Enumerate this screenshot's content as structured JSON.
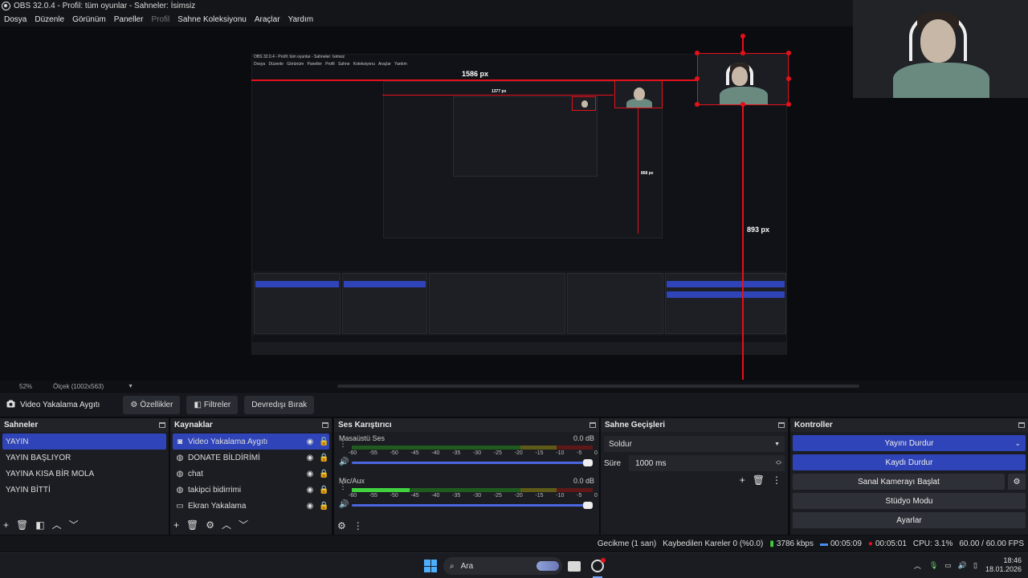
{
  "window": {
    "title": "OBS 32.0.4 - Profil: tüm oyunlar - Sahneler: İsimsiz"
  },
  "menu": [
    {
      "label": "Dosya",
      "enabled": true
    },
    {
      "label": "Düzenle",
      "enabled": true
    },
    {
      "label": "Görünüm",
      "enabled": true
    },
    {
      "label": "Paneller",
      "enabled": true
    },
    {
      "label": "Profil",
      "enabled": false
    },
    {
      "label": "Sahne Koleksiyonu",
      "enabled": true
    },
    {
      "label": "Araçlar",
      "enabled": true
    },
    {
      "label": "Yardım",
      "enabled": true
    }
  ],
  "preview": {
    "width_label": "1586 px",
    "height_label": "893 px",
    "nested_width_label": "1377 px",
    "nested_height_label": "868 px",
    "nested_title": "OBS 32.0.4 - Profil: tüm oyunlar - Sahneler: İsimsiz",
    "nested_menu": "Dosya Düzenle Görünüm Paneller Profil Sahne Koleksiyonu Araçlar Yardım"
  },
  "zoom": {
    "percent": "52%",
    "scale_label": "Ölçek (1002x563)"
  },
  "source_toolbar": {
    "selected_source": "Video Yakalama Aygıtı",
    "properties": "Özellikler",
    "filters": "Filtreler",
    "deactivate": "Devredışı Bırak"
  },
  "scenes": {
    "title": "Sahneler",
    "items": [
      "YAYIN",
      "YAYIN BAŞLIYOR",
      "YAYINA KISA BİR MOLA",
      "YAYIN BİTTİ"
    ],
    "selected_index": 0
  },
  "sources": {
    "title": "Kaynaklar",
    "items": [
      {
        "label": "Video Yakalama Aygıtı",
        "icon": "camera-icon",
        "selected": true
      },
      {
        "label": "DONATE BİLDİRİMİ",
        "icon": "globe-icon",
        "selected": false
      },
      {
        "label": "chat",
        "icon": "globe-icon",
        "selected": false
      },
      {
        "label": "takipci bidirrimi",
        "icon": "globe-icon",
        "selected": false
      },
      {
        "label": "Ekran Yakalama",
        "icon": "monitor-icon",
        "selected": false
      }
    ]
  },
  "mixer": {
    "title": "Ses Karıştırıcı",
    "channels": [
      {
        "name": "Masaüstü Ses",
        "db": "0.0 dB",
        "level": 0.0
      },
      {
        "name": "Mic/Aux",
        "db": "0.0 dB",
        "level": 0.24
      }
    ],
    "ticks": [
      "-60",
      "-55",
      "-50",
      "-45",
      "-40",
      "-35",
      "-30",
      "-25",
      "-20",
      "-15",
      "-10",
      "-5",
      "0"
    ]
  },
  "transitions": {
    "title": "Sahne Geçişleri",
    "selected": "Soldur",
    "duration_label": "Süre",
    "duration_value": "1000 ms"
  },
  "controls": {
    "title": "Kontroller",
    "stop_stream": "Yayını Durdur",
    "stop_record": "Kaydı Durdur",
    "virtual_cam": "Sanal Kamerayı Başlat",
    "studio_mode": "Stüdyo Modu",
    "settings": "Ayarlar"
  },
  "status": {
    "delay": "Gecikme (1 san)",
    "dropped": "Kaybedilen Kareler 0 (%0.0)",
    "bitrate": "3786 kbps",
    "stream_time": "00:05:09",
    "record_time": "00:05:01",
    "cpu": "CPU: 3.1%",
    "fps": "60.00 / 60.00 FPS"
  },
  "taskbar": {
    "search_placeholder": "Ara",
    "time": "18:46",
    "date": "18.01.2026"
  },
  "colors": {
    "accent": "#2f44b8",
    "guide": "#e5101a"
  }
}
